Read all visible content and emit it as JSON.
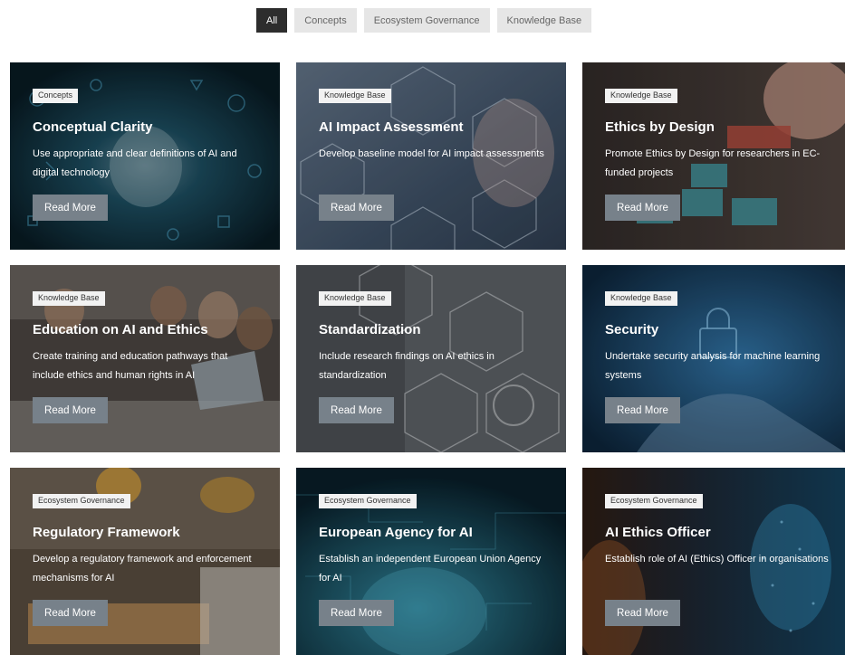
{
  "filters": [
    {
      "label": "All",
      "active": true
    },
    {
      "label": "Concepts",
      "active": false
    },
    {
      "label": "Ecosystem Governance",
      "active": false
    },
    {
      "label": "Knowledge Base",
      "active": false
    }
  ],
  "cards": [
    {
      "tag": "Concepts",
      "title": "Conceptual Clarity",
      "desc": "Use appropriate and clear definitions of AI and digital technology",
      "button": "Read More",
      "image": "lightbulb-icons-image",
      "color": "#0d2a38"
    },
    {
      "tag": "Knowledge Base",
      "title": "AI Impact Assessment",
      "desc": "Develop baseline model for AI impact assessments",
      "button": "Read More",
      "image": "machine-learning-hexagons-image",
      "color": "#3e4f63"
    },
    {
      "tag": "Knowledge Base",
      "title": "Ethics by Design",
      "desc": "Promote Ethics by Design for researchers in EC-funded projects",
      "button": "Read More",
      "image": "ethics-blocks-image",
      "color": "#3b3634"
    },
    {
      "tag": "Knowledge Base",
      "title": "Education on AI and Ethics",
      "desc": "Create training and education pathways that include ethics and human rights in AI",
      "button": "Read More",
      "image": "students-laptop-image",
      "color": "#4a4540"
    },
    {
      "tag": "Knowledge Base",
      "title": "Standardization",
      "desc": "Include research findings on AI ethics in standardization",
      "button": "Read More",
      "image": "standards-hexagons-image",
      "color": "#555a60"
    },
    {
      "tag": "Knowledge Base",
      "title": "Security",
      "desc": "Undertake security analysis for machine learning systems",
      "button": "Read More",
      "image": "security-lock-image",
      "color": "#153048"
    },
    {
      "tag": "Ecosystem Governance",
      "title": "Regulatory Framework",
      "desc": "Develop a regulatory framework and enforcement mechanisms for AI",
      "button": "Read More",
      "image": "regulation-stamp-image",
      "color": "#4a3f30"
    },
    {
      "tag": "Ecosystem Governance",
      "title": "European Agency for AI",
      "desc": "Establish an independent European Union Agency for AI",
      "button": "Read More",
      "image": "digital-brain-image",
      "color": "#0d2e3a"
    },
    {
      "tag": "Ecosystem Governance",
      "title": "AI Ethics Officer",
      "desc": "Establish role of AI (Ethics) Officer in organisations",
      "button": "Read More",
      "image": "ai-head-image",
      "color": "#1a2a38"
    }
  ]
}
